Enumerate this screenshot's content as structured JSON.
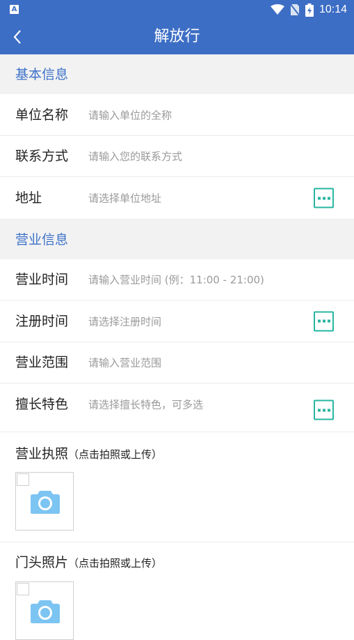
{
  "status_bar": {
    "time": "10:14",
    "notif_glyph": "A"
  },
  "app_bar": {
    "title": "解放行"
  },
  "sections": {
    "basic": "基本信息",
    "business": "营业信息"
  },
  "basic_rows": {
    "name": {
      "label": "单位名称",
      "placeholder": "请输入单位的全称"
    },
    "contact": {
      "label": "联系方式",
      "placeholder": "请输入您的联系方式"
    },
    "address": {
      "label": "地址",
      "placeholder": "请选择单位地址"
    }
  },
  "business_rows": {
    "hours": {
      "label": "营业时间",
      "placeholder": "请输入营业时间 (例：11:00 - 21:00)"
    },
    "reg_time": {
      "label": "注册时间",
      "placeholder": "请选择注册时间"
    },
    "scope": {
      "label": "营业范围",
      "placeholder": "请输入营业范围"
    },
    "specialty": {
      "label": "擅长特色",
      "placeholder": "请选择擅长特色，可多选"
    }
  },
  "uploads": {
    "license": {
      "title": "营业执照",
      "hint": "（点击拍照或上传）"
    },
    "storefront": {
      "title": "门头照片",
      "hint": "（点击拍照或上传）"
    }
  },
  "colors": {
    "primary": "#3d6ec5",
    "accent": "#27b5a1",
    "section_text": "#3d72c9",
    "camera": "#7cc4f2"
  }
}
